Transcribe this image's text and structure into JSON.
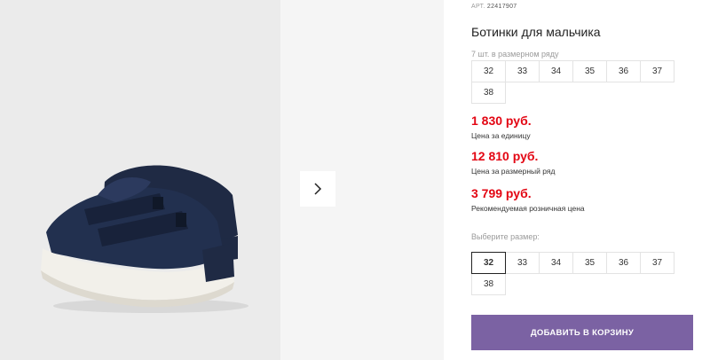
{
  "product": {
    "sku_label": "АРТ.",
    "sku_code": "22417907",
    "title": "Ботинки для мальчика"
  },
  "pack": {
    "note": "7 шт. в размерном ряду",
    "sizes": [
      "32",
      "33",
      "34",
      "35",
      "36",
      "37",
      "38"
    ]
  },
  "prices": [
    {
      "value": "1 830 руб.",
      "note": "Цена за единицу"
    },
    {
      "value": "12 810 руб.",
      "note": "Цена за размерный ряд"
    },
    {
      "value": "3 799 руб.",
      "note": "Рекомендуемая розничная цена"
    }
  ],
  "size_picker": {
    "label": "Выберите размер:",
    "sizes": [
      "32",
      "33",
      "34",
      "35",
      "36",
      "37",
      "38"
    ],
    "selected": "32"
  },
  "cart_button": {
    "label": "ДОБАВИТЬ В КОРЗИНУ"
  },
  "gallery": {
    "next_icon": "chevron-right-icon"
  },
  "colors": {
    "price": "#e30613",
    "button": "#7b62a3",
    "shoe": "#1f2a44",
    "sole": "#f2f0ea"
  }
}
